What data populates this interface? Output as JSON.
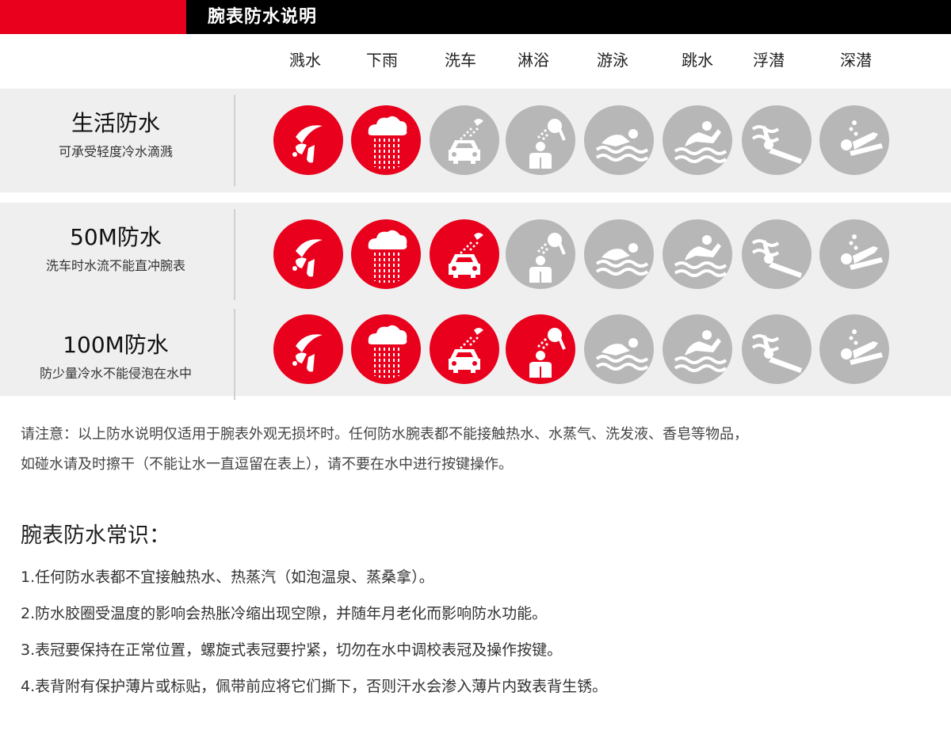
{
  "header": {
    "title": "腕表防水说明"
  },
  "columns": [
    "溅水",
    "下雨",
    "洗车",
    "淋浴",
    "游泳",
    "跳水",
    "浮潜",
    "深潜"
  ],
  "colors": {
    "active": "#e8001c",
    "inactive": "#b7b7b7",
    "row_bg": "#efefef"
  },
  "rows": [
    {
      "title": "生活防水",
      "desc": "可承受轻度冷水滴溅",
      "active_count": 2
    },
    {
      "title": "50M防水",
      "desc": "洗车时水流不能直冲腕表",
      "active_count": 3
    },
    {
      "title": "100M防水",
      "desc": "防少量冷水不能侵泡在水中",
      "active_count": 4
    }
  ],
  "icons": [
    "splash-icon",
    "rain-icon",
    "car-wash-icon",
    "shower-icon",
    "swim-icon",
    "dive-icon",
    "snorkel-icon",
    "deep-dive-icon"
  ],
  "note": {
    "line1": "请注意：以上防水说明仅适用于腕表外观无损坏时。任何防水腕表都不能接触热水、水蒸气、洗发液、香皂等物品，",
    "line2": "如碰水请及时擦干（不能让水一直逗留在表上），请不要在水中进行按键操作。"
  },
  "tips": {
    "title": "腕表防水常识：",
    "items": [
      "1.任何防水表都不宜接触热水、热蒸汽（如泡温泉、蒸桑拿）。",
      "2.防水胶圈受温度的影响会热胀冷缩出现空隙，并随年月老化而影响防水功能。",
      "3.表冠要保持在正常位置，螺旋式表冠要拧紧，切勿在水中调校表冠及操作按键。",
      "4.表背附有保护薄片或标贴，佩带前应将它们撕下，否则汗水会渗入薄片内致表背生锈。"
    ]
  }
}
